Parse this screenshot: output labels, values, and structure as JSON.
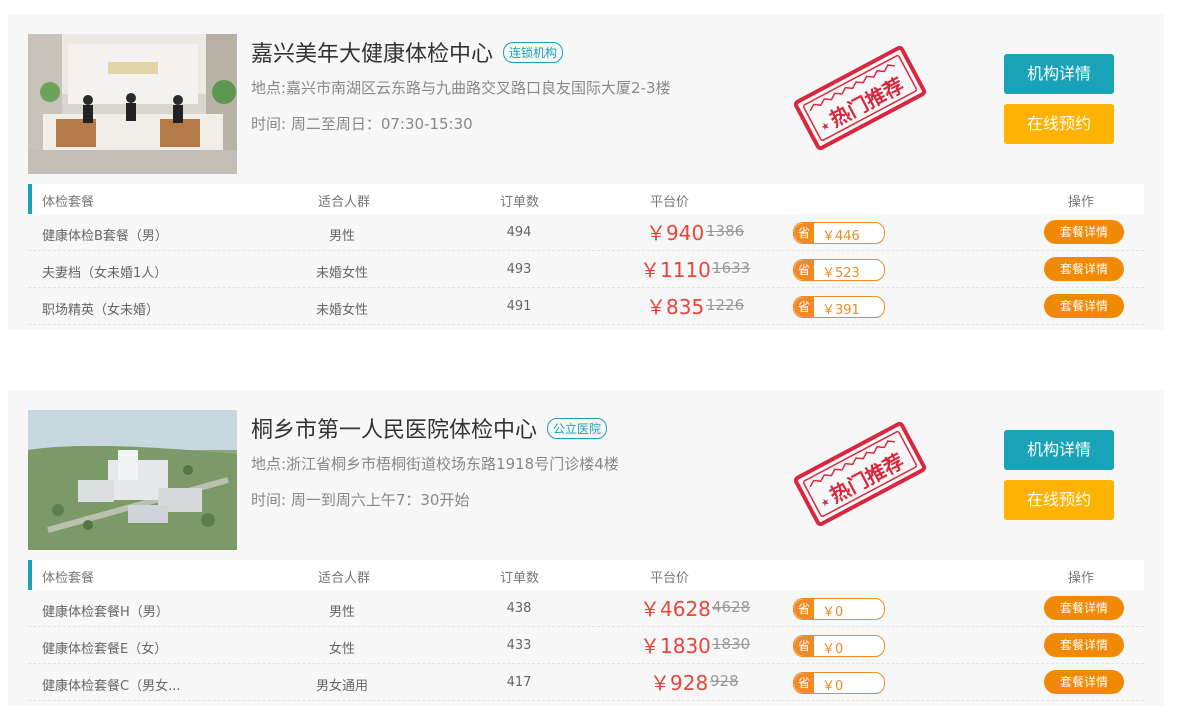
{
  "institutions": [
    {
      "name": "嘉兴美年大健康体检中心",
      "tag": "连锁机构",
      "address": "地点:嘉兴市南湖区云东路与九曲路交叉路口良友国际大厦2-3楼",
      "hours": "时间: 周二至周日：07:30-15:30",
      "stamp_text": "热门推荐",
      "detail_label": "机构详情",
      "book_label": "在线预约",
      "table_headers": {
        "package": "体检套餐",
        "crowd": "适合人群",
        "orders": "订单数",
        "price": "平台价",
        "action": "操作"
      },
      "packages": [
        {
          "name": "健康体检B套餐（男）",
          "crowd": "男性",
          "orders": "494",
          "price": "￥940",
          "original": "1386",
          "save": "￥446",
          "save_prefix": "省",
          "action": "套餐详情"
        },
        {
          "name": "夫妻档（女未婚1人）",
          "crowd": "未婚女性",
          "orders": "493",
          "price": "￥1110",
          "original": "1633",
          "save": "￥523",
          "save_prefix": "省",
          "action": "套餐详情"
        },
        {
          "name": "职场精英（女未婚）",
          "crowd": "未婚女性",
          "orders": "491",
          "price": "￥835",
          "original": "1226",
          "save": "￥391",
          "save_prefix": "省",
          "action": "套餐详情"
        }
      ]
    },
    {
      "name": "桐乡市第一人民医院体检中心",
      "tag": "公立医院",
      "address": "地点:浙江省桐乡市梧桐街道校场东路1918号门诊楼4楼",
      "hours": "时间: 周一到周六上午7：30开始",
      "stamp_text": "热门推荐",
      "detail_label": "机构详情",
      "book_label": "在线预约",
      "table_headers": {
        "package": "体检套餐",
        "crowd": "适合人群",
        "orders": "订单数",
        "price": "平台价",
        "action": "操作"
      },
      "packages": [
        {
          "name": "健康体检套餐H（男）",
          "crowd": "男性",
          "orders": "438",
          "price": "￥4628",
          "original": "4628",
          "save": "￥0",
          "save_prefix": "省",
          "action": "套餐详情"
        },
        {
          "name": "健康体检套餐E（女）",
          "crowd": "女性",
          "orders": "433",
          "price": "￥1830",
          "original": "1830",
          "save": "￥0",
          "save_prefix": "省",
          "action": "套餐详情"
        },
        {
          "name": "健康体检套餐C（男女...",
          "crowd": "男女通用",
          "orders": "417",
          "price": "￥928",
          "original": "928",
          "save": "￥0",
          "save_prefix": "省",
          "action": "套餐详情"
        }
      ]
    }
  ],
  "colors": {
    "accent": "#1aa3b8",
    "book": "#fdb300",
    "price": "#e8453c",
    "save": "#f08a24",
    "stamp": "#d8283f"
  }
}
